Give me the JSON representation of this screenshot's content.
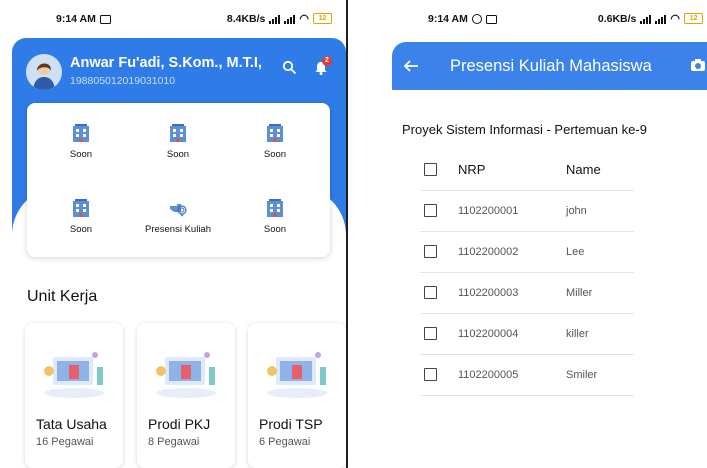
{
  "left_phone": {
    "status": {
      "time": "9:14 AM",
      "network": "8.4KB/s",
      "battery": "12"
    },
    "profile": {
      "name": "Anwar Fu'adi, S.Kom., M.T.I,",
      "id": "198805012019031010"
    },
    "notification_count": "2",
    "menu": [
      {
        "label": "Soon",
        "icon": "building-icon"
      },
      {
        "label": "Soon",
        "icon": "building-icon"
      },
      {
        "label": "Soon",
        "icon": "building-icon"
      },
      {
        "label": "Soon",
        "icon": "building-icon"
      },
      {
        "label": "Presensi Kuliah",
        "icon": "fingerprint-hand-icon"
      },
      {
        "label": "Soon",
        "icon": "building-icon"
      }
    ],
    "unit_section_title": "Unit Kerja",
    "units": [
      {
        "name": "Tata Usaha",
        "count": "16 Pegawai"
      },
      {
        "name": "Prodi PKJ",
        "count": "8 Pegawai"
      },
      {
        "name": "Prodi TSP",
        "count": "6 Pegawai"
      }
    ],
    "colors": {
      "primary": "#2f7ce8",
      "badge": "#e53935"
    }
  },
  "right_phone": {
    "status": {
      "time": "9:14 AM",
      "network": "0.6KB/s",
      "battery": "12"
    },
    "appbar_title": "Presensi Kuliah Mahasiswa",
    "course_title": "Proyek Sistem Informasi - Pertemuan ke-9",
    "table": {
      "headers": {
        "nrp": "NRP",
        "name": "Name"
      },
      "rows": [
        {
          "nrp": "1102200001",
          "name": "john"
        },
        {
          "nrp": "1102200002",
          "name": "Lee"
        },
        {
          "nrp": "1102200003",
          "name": "Miller"
        },
        {
          "nrp": "1102200004",
          "name": "killer"
        },
        {
          "nrp": "1102200005",
          "name": "Smiler"
        }
      ]
    },
    "colors": {
      "primary": "#3b82ea"
    }
  }
}
